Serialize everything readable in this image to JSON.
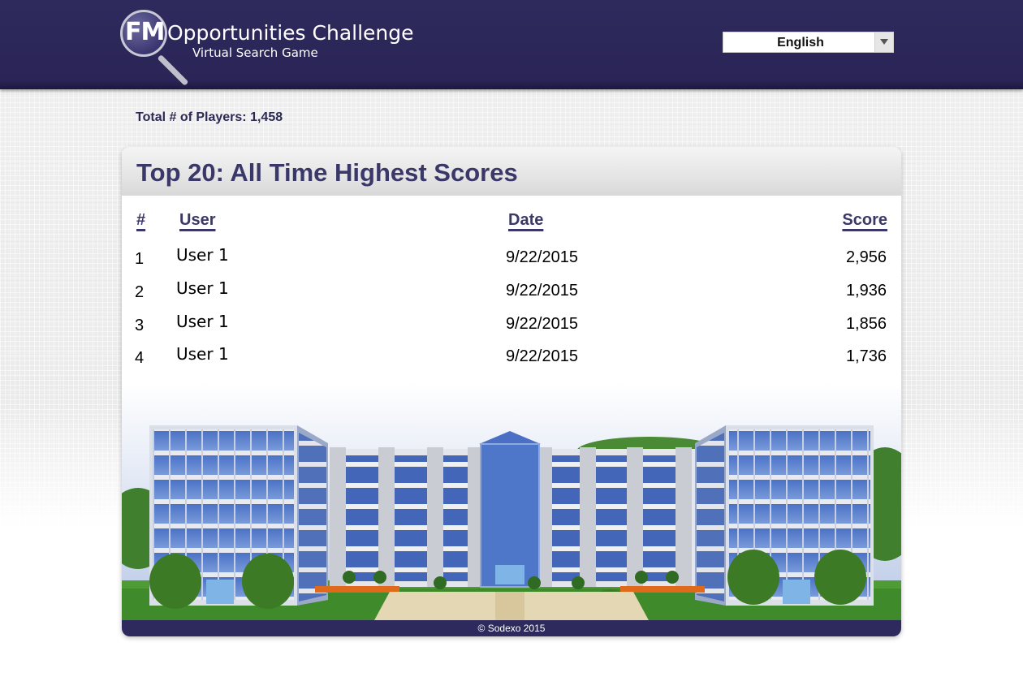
{
  "header": {
    "logo_fm": "FM",
    "logo_title": "Opportunities Challenge",
    "logo_subtitle": "Virtual Search Game",
    "language": "English"
  },
  "stats": {
    "players_label": "Total # of Players: 1,458"
  },
  "scores": {
    "title": "Top 20: All Time Highest Scores",
    "columns": [
      "#",
      "User",
      "Date",
      "Score"
    ],
    "rows": [
      {
        "rank": "1",
        "user": "User 1",
        "date": "9/22/2015",
        "score": "2,956"
      },
      {
        "rank": "2",
        "user": "User 1",
        "date": "9/22/2015",
        "score": "1,936"
      },
      {
        "rank": "3",
        "user": "User 1",
        "date": "9/22/2015",
        "score": "1,856"
      },
      {
        "rank": "4",
        "user": "User 1",
        "date": "9/22/2015",
        "score": "1,736"
      }
    ]
  },
  "footer": {
    "copyright": "© Sodexo 2015"
  },
  "colors": {
    "header_bg": "#2f2a5d",
    "title_text": "#3a3868",
    "glass": "#4c74c4",
    "grass": "#3f8a2a"
  },
  "icons": [
    "magnifier-logo-icon",
    "dropdown-arrow-icon",
    "building-illustration"
  ]
}
